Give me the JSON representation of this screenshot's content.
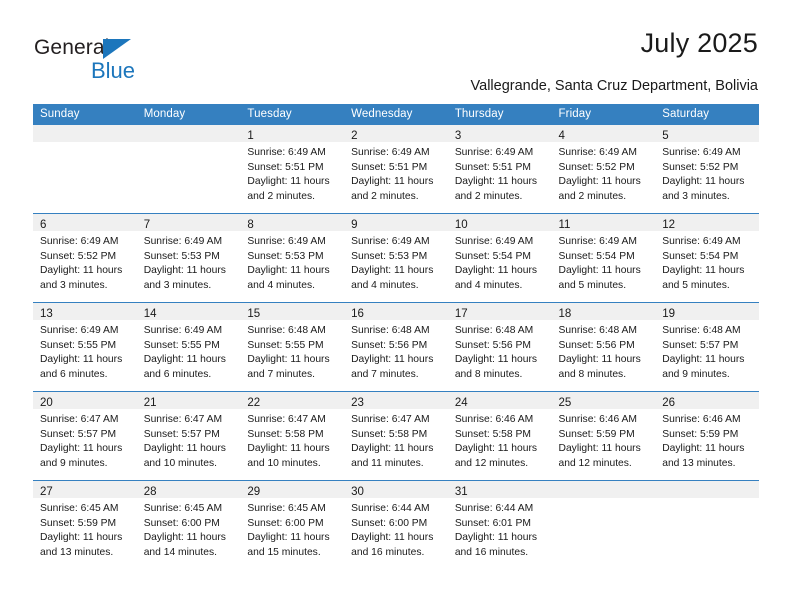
{
  "brand": {
    "name_part1": "General",
    "name_part2": "Blue"
  },
  "header": {
    "title": "July 2025",
    "subtitle": "Vallegrande, Santa Cruz Department, Bolivia"
  },
  "colors": {
    "header_blue": "#3580c0",
    "brand_blue": "#1c76bc",
    "daynum_band": "#f0f0f0"
  },
  "calendar": {
    "weekday_headers": [
      "Sunday",
      "Monday",
      "Tuesday",
      "Wednesday",
      "Thursday",
      "Friday",
      "Saturday"
    ],
    "weeks": [
      [
        {
          "day": "",
          "lines": []
        },
        {
          "day": "",
          "lines": []
        },
        {
          "day": "1",
          "lines": [
            "Sunrise: 6:49 AM",
            "Sunset: 5:51 PM",
            "Daylight: 11 hours",
            "and 2 minutes."
          ]
        },
        {
          "day": "2",
          "lines": [
            "Sunrise: 6:49 AM",
            "Sunset: 5:51 PM",
            "Daylight: 11 hours",
            "and 2 minutes."
          ]
        },
        {
          "day": "3",
          "lines": [
            "Sunrise: 6:49 AM",
            "Sunset: 5:51 PM",
            "Daylight: 11 hours",
            "and 2 minutes."
          ]
        },
        {
          "day": "4",
          "lines": [
            "Sunrise: 6:49 AM",
            "Sunset: 5:52 PM",
            "Daylight: 11 hours",
            "and 2 minutes."
          ]
        },
        {
          "day": "5",
          "lines": [
            "Sunrise: 6:49 AM",
            "Sunset: 5:52 PM",
            "Daylight: 11 hours",
            "and 3 minutes."
          ]
        }
      ],
      [
        {
          "day": "6",
          "lines": [
            "Sunrise: 6:49 AM",
            "Sunset: 5:52 PM",
            "Daylight: 11 hours",
            "and 3 minutes."
          ]
        },
        {
          "day": "7",
          "lines": [
            "Sunrise: 6:49 AM",
            "Sunset: 5:53 PM",
            "Daylight: 11 hours",
            "and 3 minutes."
          ]
        },
        {
          "day": "8",
          "lines": [
            "Sunrise: 6:49 AM",
            "Sunset: 5:53 PM",
            "Daylight: 11 hours",
            "and 4 minutes."
          ]
        },
        {
          "day": "9",
          "lines": [
            "Sunrise: 6:49 AM",
            "Sunset: 5:53 PM",
            "Daylight: 11 hours",
            "and 4 minutes."
          ]
        },
        {
          "day": "10",
          "lines": [
            "Sunrise: 6:49 AM",
            "Sunset: 5:54 PM",
            "Daylight: 11 hours",
            "and 4 minutes."
          ]
        },
        {
          "day": "11",
          "lines": [
            "Sunrise: 6:49 AM",
            "Sunset: 5:54 PM",
            "Daylight: 11 hours",
            "and 5 minutes."
          ]
        },
        {
          "day": "12",
          "lines": [
            "Sunrise: 6:49 AM",
            "Sunset: 5:54 PM",
            "Daylight: 11 hours",
            "and 5 minutes."
          ]
        }
      ],
      [
        {
          "day": "13",
          "lines": [
            "Sunrise: 6:49 AM",
            "Sunset: 5:55 PM",
            "Daylight: 11 hours",
            "and 6 minutes."
          ]
        },
        {
          "day": "14",
          "lines": [
            "Sunrise: 6:49 AM",
            "Sunset: 5:55 PM",
            "Daylight: 11 hours",
            "and 6 minutes."
          ]
        },
        {
          "day": "15",
          "lines": [
            "Sunrise: 6:48 AM",
            "Sunset: 5:55 PM",
            "Daylight: 11 hours",
            "and 7 minutes."
          ]
        },
        {
          "day": "16",
          "lines": [
            "Sunrise: 6:48 AM",
            "Sunset: 5:56 PM",
            "Daylight: 11 hours",
            "and 7 minutes."
          ]
        },
        {
          "day": "17",
          "lines": [
            "Sunrise: 6:48 AM",
            "Sunset: 5:56 PM",
            "Daylight: 11 hours",
            "and 8 minutes."
          ]
        },
        {
          "day": "18",
          "lines": [
            "Sunrise: 6:48 AM",
            "Sunset: 5:56 PM",
            "Daylight: 11 hours",
            "and 8 minutes."
          ]
        },
        {
          "day": "19",
          "lines": [
            "Sunrise: 6:48 AM",
            "Sunset: 5:57 PM",
            "Daylight: 11 hours",
            "and 9 minutes."
          ]
        }
      ],
      [
        {
          "day": "20",
          "lines": [
            "Sunrise: 6:47 AM",
            "Sunset: 5:57 PM",
            "Daylight: 11 hours",
            "and 9 minutes."
          ]
        },
        {
          "day": "21",
          "lines": [
            "Sunrise: 6:47 AM",
            "Sunset: 5:57 PM",
            "Daylight: 11 hours",
            "and 10 minutes."
          ]
        },
        {
          "day": "22",
          "lines": [
            "Sunrise: 6:47 AM",
            "Sunset: 5:58 PM",
            "Daylight: 11 hours",
            "and 10 minutes."
          ]
        },
        {
          "day": "23",
          "lines": [
            "Sunrise: 6:47 AM",
            "Sunset: 5:58 PM",
            "Daylight: 11 hours",
            "and 11 minutes."
          ]
        },
        {
          "day": "24",
          "lines": [
            "Sunrise: 6:46 AM",
            "Sunset: 5:58 PM",
            "Daylight: 11 hours",
            "and 12 minutes."
          ]
        },
        {
          "day": "25",
          "lines": [
            "Sunrise: 6:46 AM",
            "Sunset: 5:59 PM",
            "Daylight: 11 hours",
            "and 12 minutes."
          ]
        },
        {
          "day": "26",
          "lines": [
            "Sunrise: 6:46 AM",
            "Sunset: 5:59 PM",
            "Daylight: 11 hours",
            "and 13 minutes."
          ]
        }
      ],
      [
        {
          "day": "27",
          "lines": [
            "Sunrise: 6:45 AM",
            "Sunset: 5:59 PM",
            "Daylight: 11 hours",
            "and 13 minutes."
          ]
        },
        {
          "day": "28",
          "lines": [
            "Sunrise: 6:45 AM",
            "Sunset: 6:00 PM",
            "Daylight: 11 hours",
            "and 14 minutes."
          ]
        },
        {
          "day": "29",
          "lines": [
            "Sunrise: 6:45 AM",
            "Sunset: 6:00 PM",
            "Daylight: 11 hours",
            "and 15 minutes."
          ]
        },
        {
          "day": "30",
          "lines": [
            "Sunrise: 6:44 AM",
            "Sunset: 6:00 PM",
            "Daylight: 11 hours",
            "and 16 minutes."
          ]
        },
        {
          "day": "31",
          "lines": [
            "Sunrise: 6:44 AM",
            "Sunset: 6:01 PM",
            "Daylight: 11 hours",
            "and 16 minutes."
          ]
        },
        {
          "day": "",
          "lines": []
        },
        {
          "day": "",
          "lines": []
        }
      ]
    ]
  }
}
